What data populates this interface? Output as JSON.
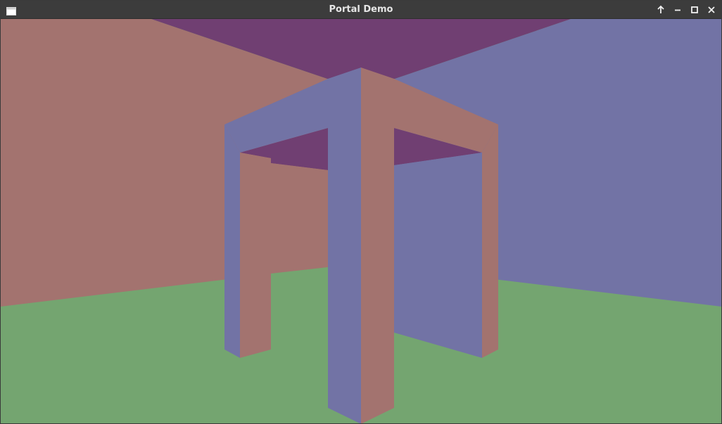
{
  "window": {
    "title": "Portal Demo"
  },
  "titlebar": {
    "app_icon": "window-icon",
    "controls": [
      {
        "name": "keep-above",
        "icon": "arrow-up-icon"
      },
      {
        "name": "minimize",
        "icon": "minimize-icon"
      },
      {
        "name": "maximize",
        "icon": "maximize-icon"
      },
      {
        "name": "close",
        "icon": "close-icon"
      }
    ],
    "colors": {
      "background": "#3c3c3c",
      "text": "#e6e6e6",
      "icon": "#f0f0f0"
    }
  },
  "scene": {
    "colors": {
      "floor": "#74a570",
      "ceiling": "#703f72",
      "wall_red": "#a3736f",
      "wall_blue": "#7273a5"
    }
  }
}
